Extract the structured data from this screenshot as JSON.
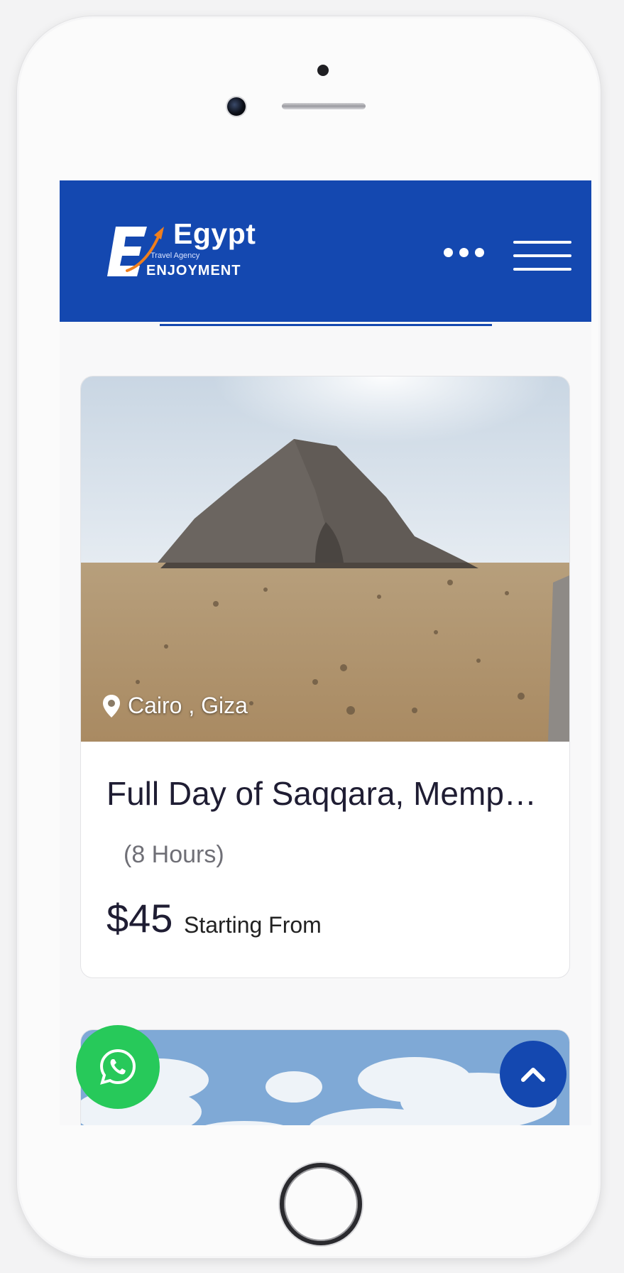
{
  "header": {
    "logo_title": "Egypt",
    "logo_subtitle": "Travel Agency",
    "logo_bottom": "ENJOYMENT",
    "background": "#1448b0"
  },
  "tour_card": {
    "location": "Cairo , Giza",
    "title": "Full Day of Saqqara, Memp…",
    "duration": "(8 Hours)",
    "price": "$45",
    "price_note": "Starting From"
  },
  "colors": {
    "brand_blue": "#1448b0",
    "whatsapp_green": "#27c95a",
    "logo_accent": "#f07f1d"
  },
  "icons": [
    "location-pin-icon",
    "whatsapp-icon",
    "chevron-up-icon",
    "more-dots-icon",
    "hamburger-menu-icon"
  ]
}
